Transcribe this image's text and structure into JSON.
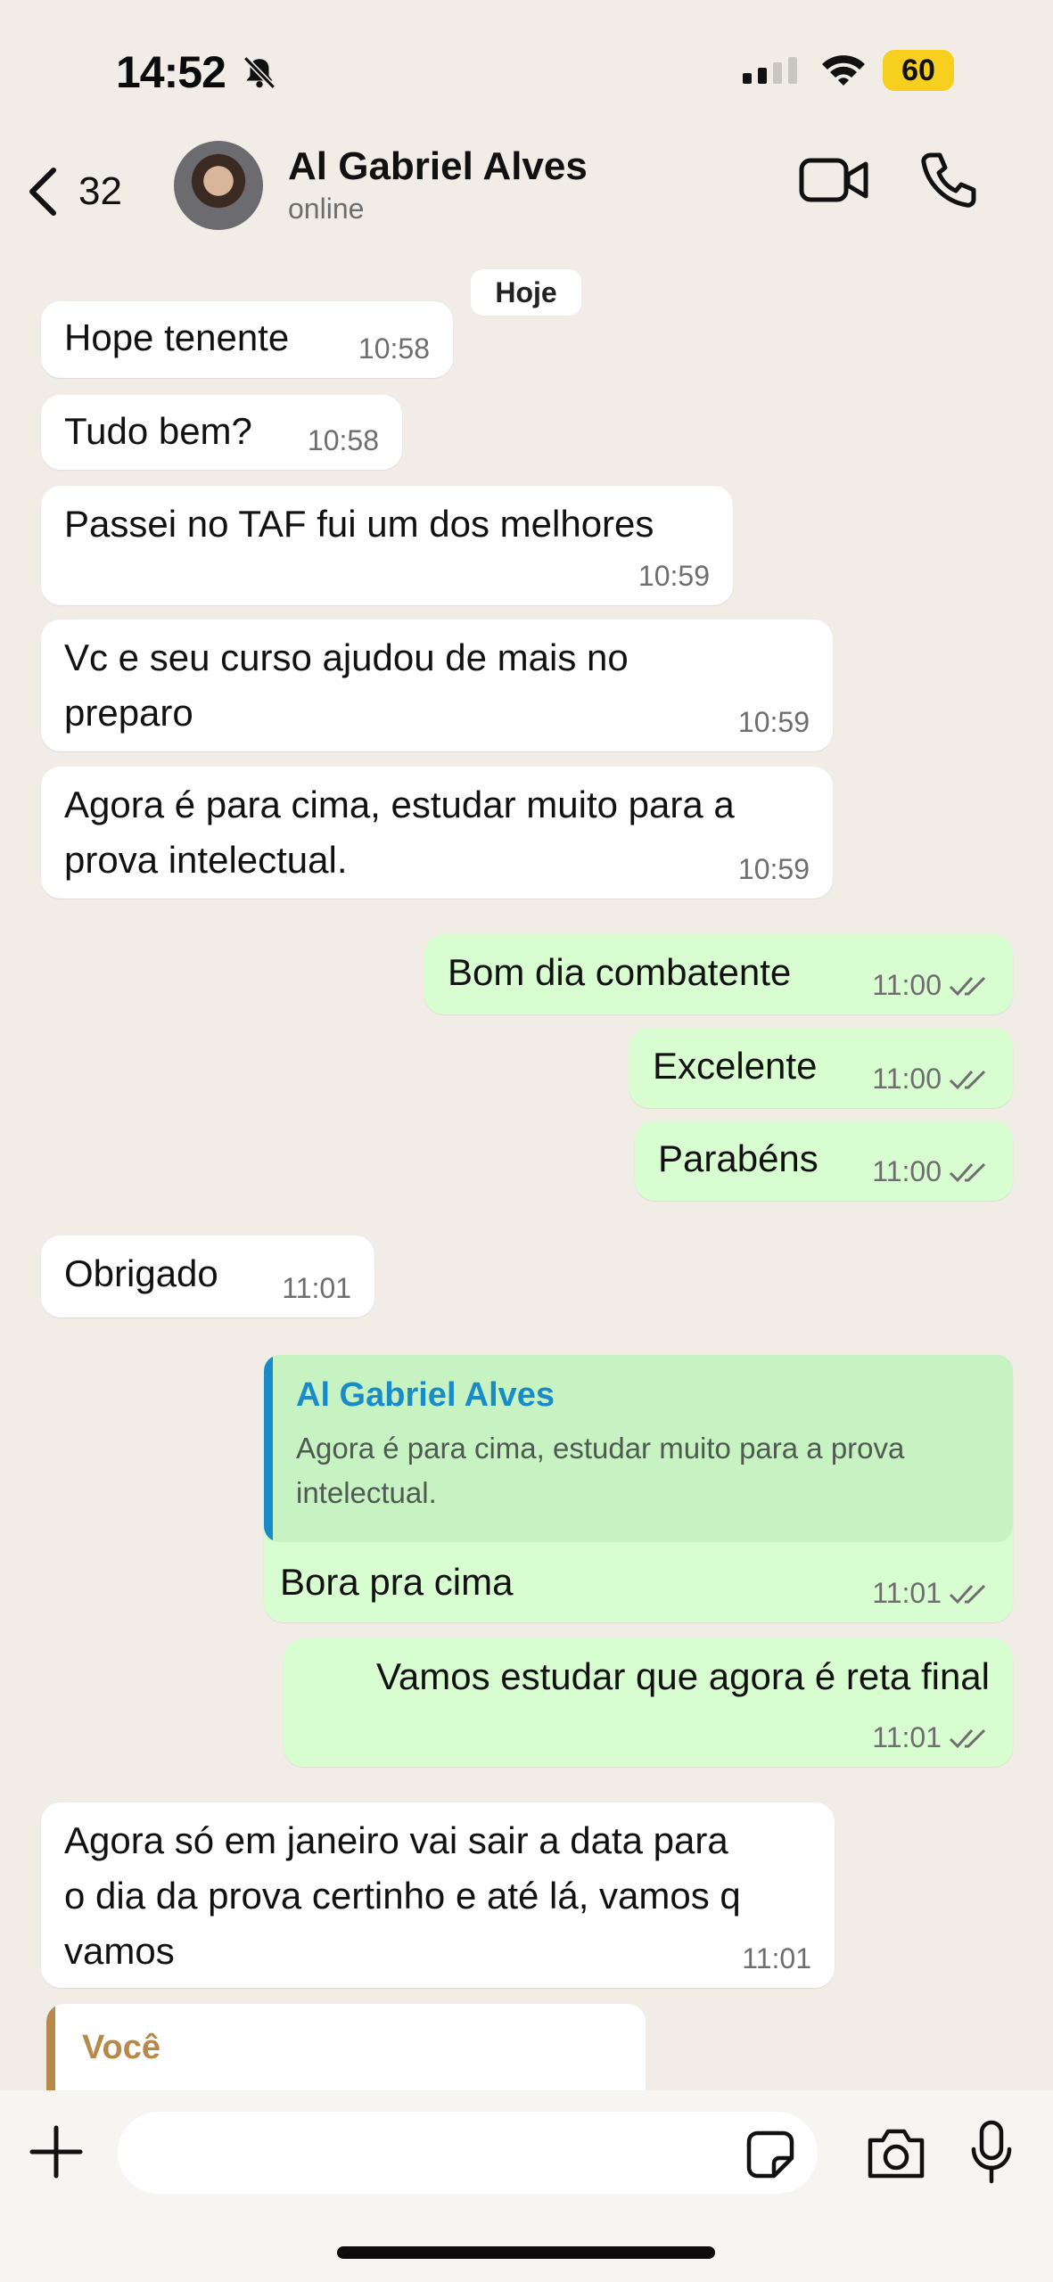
{
  "status_bar": {
    "time": "14:52",
    "battery": "60",
    "battery_color": "#f6cf1f",
    "icons": [
      "bell-slash-icon",
      "signal-icon",
      "wifi-icon",
      "battery-icon"
    ]
  },
  "header": {
    "back_count": "32",
    "contact_name": "Al Gabriel Alves",
    "contact_status": "online",
    "icons": [
      "chevron-left-icon",
      "video-icon",
      "phone-icon"
    ]
  },
  "day_chip": "Hoje",
  "messages": [
    {
      "text": "Hope tenente",
      "time": "10:58"
    },
    {
      "text": "Tudo bem?",
      "time": "10:58"
    },
    {
      "text": "Passei no TAF fui um dos melhores",
      "time": "10:59"
    },
    {
      "text_l1": "Vc e seu curso ajudou de mais no",
      "text_l2": "preparo",
      "time": "10:59"
    },
    {
      "text_l1": "Agora é para cima, estudar muito para a",
      "text_l2": "prova intelectual.",
      "time": "10:59"
    },
    {
      "text": "Bom dia combatente",
      "time": "11:00"
    },
    {
      "text": "Excelente",
      "time": "11:00"
    },
    {
      "text": "Parabéns",
      "time": "11:00"
    },
    {
      "text": "Obrigado",
      "time": "11:01"
    },
    {
      "quote_author": "Al Gabriel Alves",
      "quote_l1": "Agora é para cima, estudar muito para a prova",
      "quote_l2": "intelectual.",
      "text": "Bora pra cima",
      "time": "11:01"
    },
    {
      "text": "Vamos estudar que agora é reta final",
      "time": "11:01"
    },
    {
      "text_l1": "Agora só em janeiro vai sair a data para",
      "text_l2": "o dia da prova certinho e até lá, vamos q",
      "text_l3": "vamos",
      "time": "11:01"
    },
    {
      "quote_author": "Você"
    }
  ],
  "colors": {
    "incoming_bubble": "#ffffff",
    "outgoing_bubble": "#d7fdd0",
    "quote_accent": "#1a8bc9",
    "own_quote_accent": "#b8894a",
    "wallpaper": "#f1ede6"
  },
  "composer": {
    "placeholder": "",
    "icons": [
      "plus-icon",
      "sticker-icon",
      "camera-icon",
      "microphone-icon"
    ]
  }
}
